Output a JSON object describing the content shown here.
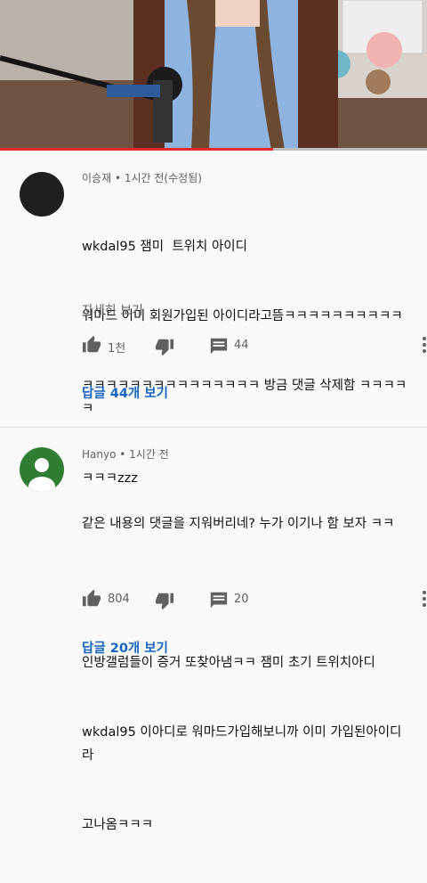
{
  "video": {
    "progress": 0.64
  },
  "comments": [
    {
      "author": "이승재",
      "time": "1시간 전(수정됨)",
      "lines": [
        "wkdal95 잼미  트위치 아이디",
        "워마드 이미 회원가입된 아이디라고뜸ㅋㅋㅋㅋㅋㅋㅋㅋㅋㅋ",
        "ㅋㅋㅋㅋㅋㅋㅋㅋㅋㅋㅋㅋㅋㅋㅋ 방금 댓글 삭제함 ㅋㅋㅋㅋㅋ",
        "ㅋㅋㅋzzz"
      ],
      "read_more": "자세히 보기",
      "likes": "1천",
      "reply_count": "44",
      "replies_link": "답글 44개 보기",
      "avatar_color": "#1f1f1f"
    },
    {
      "author": "Hanyo",
      "time": "1시간 전",
      "lines": [
        "같은 내용의 댓글을 지워버리네? 누가 이기나 함 보자 ㅋㅋ",
        "",
        "인방갤럼들이 증거 또찾아냄ㅋㅋ 잼미 초기 트위치아디",
        "wkdal95 이아디로 워마드가입해보니까 이미 가입된아이디라",
        "고나옴ㅋㅋㅋ"
      ],
      "likes": "804",
      "reply_count": "20",
      "replies_link": "답글 20개 보기",
      "avatar_color": "#2e7d32"
    }
  ]
}
